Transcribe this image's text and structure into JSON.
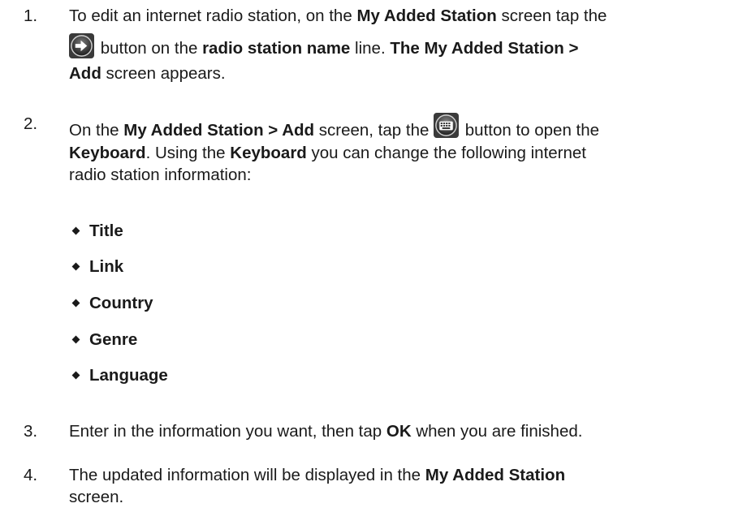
{
  "steps": [
    {
      "number": "1.",
      "line1_a": "To edit an internet radio station, on the ",
      "line1_b": "My Added Station",
      "line1_c": " screen tap the",
      "line2_a": " button on the ",
      "line2_b": "radio station name",
      "line2_c": " line.  ",
      "line2_d": "The My Added Station >",
      "line3_a": "Add",
      "line3_b": " screen appears.",
      "icon": "arrow-right-icon"
    },
    {
      "number": "2.",
      "line1_a": "On the ",
      "line1_b": "My Added Station > Add",
      "line1_c": " screen, tap the ",
      "line1_d": " button to open the",
      "line2_a": "Keyboard",
      "line2_b": ".  Using the ",
      "line2_c": "Keyboard",
      "line2_d": " you can change the following internet",
      "line3": "radio station information:",
      "icon": "keyboard-icon",
      "bullets": [
        "Title",
        "Link",
        "Country",
        "Genre",
        "Language"
      ]
    },
    {
      "number": "3.",
      "text_a": "Enter in the information you want, then tap ",
      "text_b": "OK",
      "text_c": " when you are finished."
    },
    {
      "number": "4.",
      "line1_a": "The updated information will be displayed in the ",
      "line1_b": "My Added Station",
      "line2": "screen."
    }
  ]
}
